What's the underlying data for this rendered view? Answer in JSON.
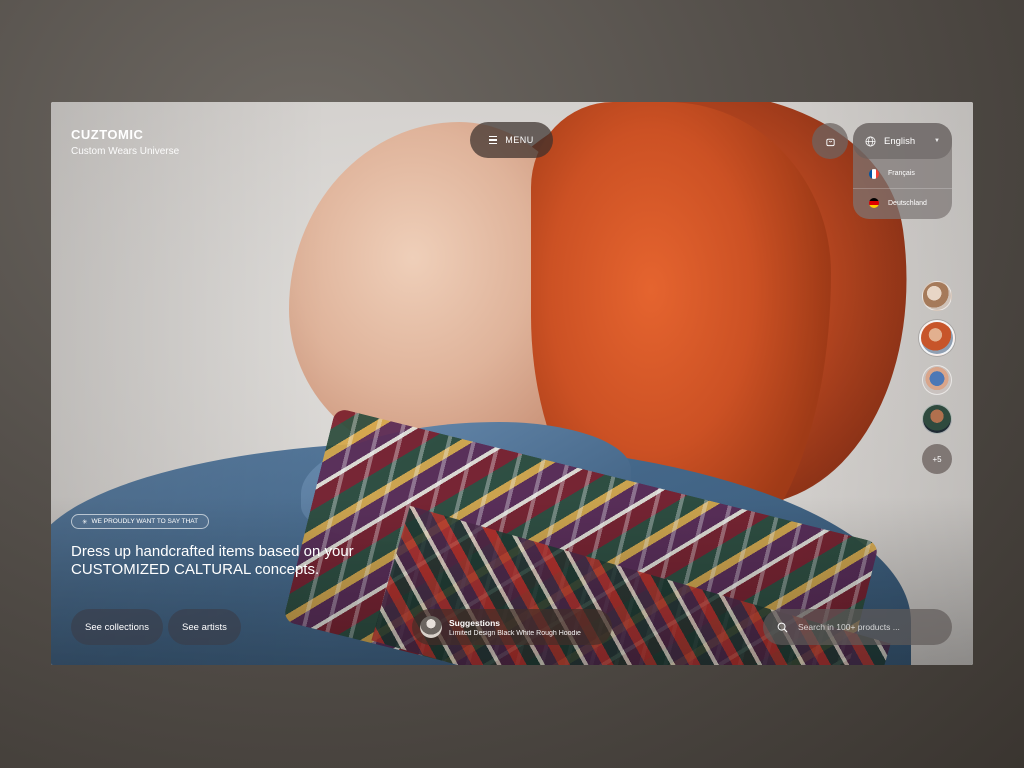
{
  "brand": {
    "logo": "CUZTOMIC",
    "tagline": "Custom Wears Universe"
  },
  "menu": {
    "label": "MENU",
    "icon": "hamburger-icon"
  },
  "cart": {
    "icon": "shopping-bag-icon"
  },
  "language": {
    "icon": "globe-icon",
    "current": "English",
    "options": [
      {
        "label": "Français",
        "flag": "flag-france-icon",
        "colors": [
          "#0055a4",
          "#ffffff",
          "#ef4135"
        ]
      },
      {
        "label": "Deutschland",
        "flag": "flag-germany-icon",
        "colors": [
          "#000000",
          "#dd0000",
          "#ffce00"
        ]
      }
    ]
  },
  "artists": {
    "more_label": "+5"
  },
  "hero": {
    "note": "WE PROUDLY WANT TO SAY THAT",
    "note_icon": "sparkle-icon",
    "headline_line1": "Dress up handcrafted items based on your",
    "headline_line2": "CUSTOMIZED CALTURAL concepts."
  },
  "actions": {
    "collections_label": "See collections",
    "artists_label": "See artists"
  },
  "suggestion": {
    "title": "Suggestions",
    "item": "Limited Design Black White Rough Hoodie"
  },
  "search": {
    "placeholder": "Search in 100+ products ...",
    "icon": "search-icon"
  },
  "colors": {
    "page_bg": "#55504b",
    "hair": "#cc5124",
    "denim": "#446789"
  }
}
